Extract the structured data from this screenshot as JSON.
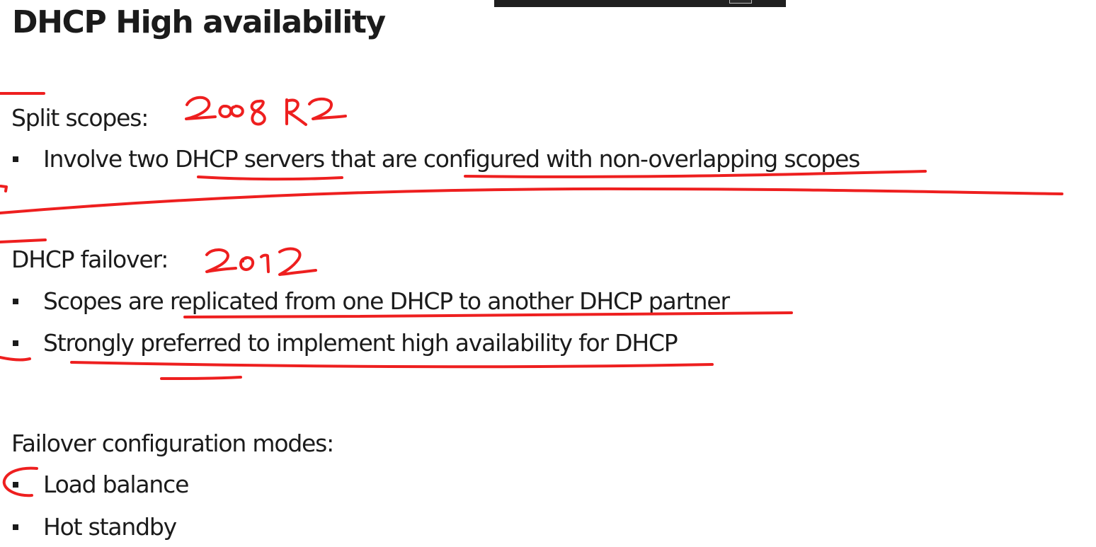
{
  "title": "DHCP High availability",
  "sections": [
    {
      "heading": "Split scopes:",
      "bullets": [
        "Involve two DHCP servers that are configured with non-overlapping scopes"
      ]
    },
    {
      "heading": "DHCP failover:",
      "bullets": [
        "Scopes are replicated from one DHCP to another DHCP partner",
        "Strongly preferred to implement high availability for DHCP"
      ]
    },
    {
      "heading": "Failover configuration modes:",
      "bullets": [
        "Load balance",
        "Hot standby"
      ]
    }
  ],
  "annotations": {
    "split_scopes_note": "2008R2",
    "failover_note": "2012"
  },
  "colors": {
    "ink": "#ee1f1f",
    "text": "#1b1b1b",
    "background": "#ffffff"
  }
}
